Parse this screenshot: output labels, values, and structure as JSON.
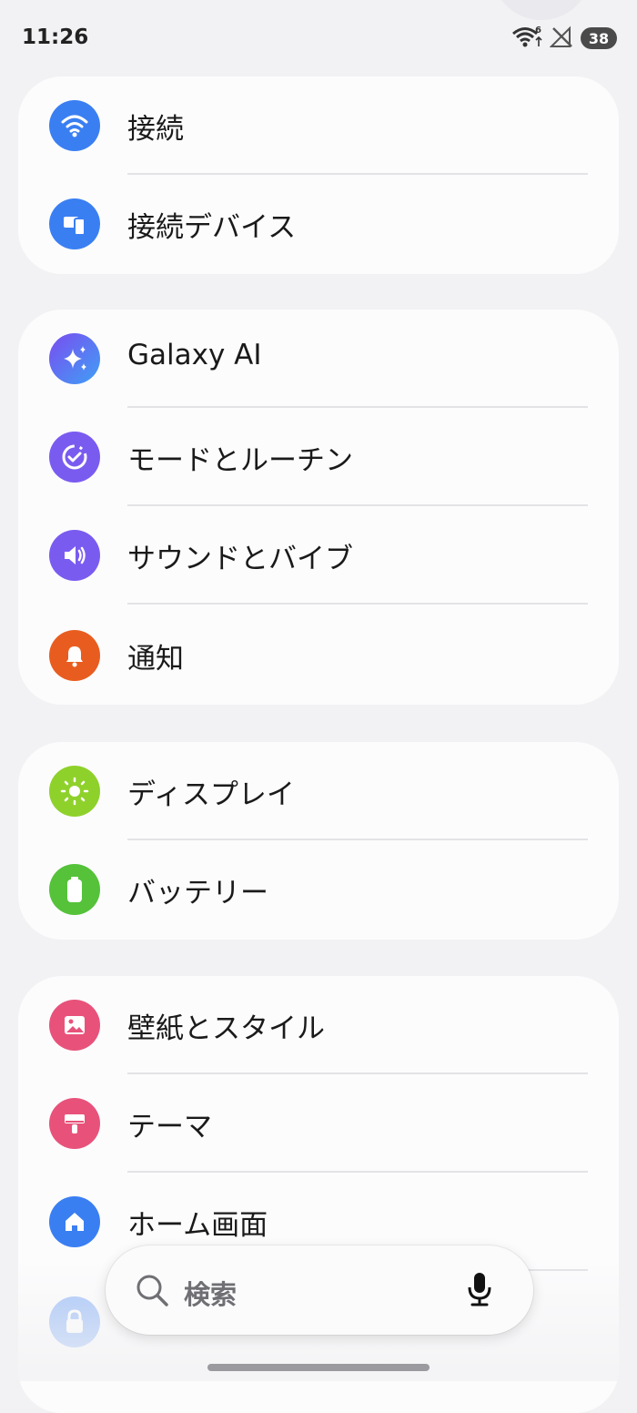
{
  "status_bar": {
    "time": "11:26",
    "battery": "38"
  },
  "groups": [
    {
      "items": [
        {
          "label": "接続",
          "icon": "wifi-icon",
          "color": "#3a7ff2"
        },
        {
          "label": "接続デバイス",
          "icon": "devices-icon",
          "color": "#3a7ff2"
        }
      ]
    },
    {
      "items": [
        {
          "label": "Galaxy AI",
          "icon": "galaxy-ai-sparkle-icon",
          "color": "#5b6df2"
        },
        {
          "label": "モードとルーチン",
          "icon": "modes-routines-icon",
          "color": "#7a5bf0"
        },
        {
          "label": "サウンドとバイブ",
          "icon": "sound-icon",
          "color": "#7a5bf0"
        },
        {
          "label": "通知",
          "icon": "bell-icon",
          "color": "#e85d1f"
        }
      ]
    },
    {
      "items": [
        {
          "label": "ディスプレイ",
          "icon": "sun-icon",
          "color": "#8fd12b"
        },
        {
          "label": "バッテリー",
          "icon": "battery-icon",
          "color": "#55c23a"
        }
      ]
    },
    {
      "items": [
        {
          "label": "壁紙とスタイル",
          "icon": "wallpaper-icon",
          "color": "#e8527a"
        },
        {
          "label": "テーマ",
          "icon": "theme-brush-icon",
          "color": "#e8527a"
        },
        {
          "label": "ホーム画面",
          "icon": "home-icon",
          "color": "#3a7ff2"
        },
        {
          "label": "",
          "icon": "lock-icon",
          "color": "#3a7ff2"
        }
      ]
    }
  ],
  "search": {
    "placeholder": "検索"
  }
}
